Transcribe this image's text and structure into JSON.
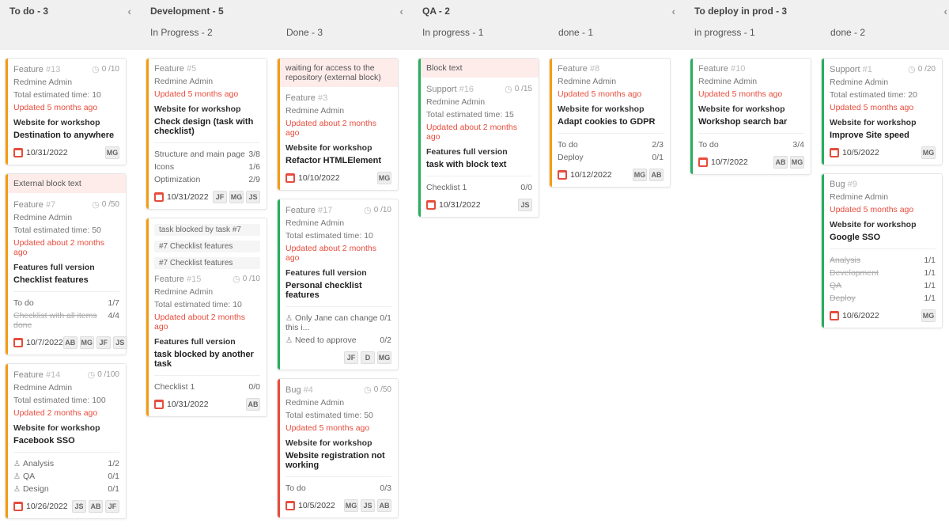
{
  "columns": [
    {
      "title": "To do - 3",
      "collapsible": true,
      "sub": null,
      "cards": [
        {
          "stripe": "orange",
          "tracker": "Feature",
          "id": "#13",
          "progress": "0 /10",
          "author": "Redmine Admin",
          "est": "Total estimated time: 10",
          "updated": "Updated 5 months ago",
          "project": "Website for workshop",
          "subject": "Destination to anywhere",
          "date": "10/31/2022",
          "avatars": [
            "MG"
          ]
        },
        {
          "stripe": "orange",
          "banner": "External block text",
          "tracker": "Feature",
          "id": "#7",
          "progress": "0 /50",
          "author": "Redmine Admin",
          "est": "Total estimated time: 50",
          "updated": "Updated about 2 months ago",
          "project": "Features full version",
          "subject": "Checklist features",
          "rows": [
            {
              "label": "To do",
              "val": "1/7"
            },
            {
              "label": "Checklist with all items done",
              "val": "4/4",
              "strike": true
            }
          ],
          "date": "10/7/2022",
          "avatars": [
            "AB",
            "MG",
            "JF",
            "JS"
          ]
        },
        {
          "stripe": "orange",
          "tracker": "Feature",
          "id": "#14",
          "progress": "0 /100",
          "author": "Redmine Admin",
          "est": "Total estimated time: 100",
          "updated": "Updated 2 months ago",
          "project": "Website for workshop",
          "subject": "Facebook SSO",
          "rows": [
            {
              "label": "Analysis",
              "val": "1/2",
              "person": true
            },
            {
              "label": "QA",
              "val": "0/1",
              "person": true
            },
            {
              "label": "Design",
              "val": "0/1",
              "person": true
            }
          ],
          "date": "10/26/2022",
          "avatars": [
            "JS",
            "AB",
            "JF"
          ]
        }
      ]
    },
    {
      "title": "Development - 5",
      "collapsible": true,
      "sub": [
        {
          "title": "In Progress - 2",
          "cards": [
            {
              "stripe": "orange",
              "tracker": "Feature",
              "id": "#5",
              "author": "Redmine Admin",
              "updated": "Updated 5 months ago",
              "project": "Website for workshop",
              "subject": "Check design (task with checklist)",
              "rows": [
                {
                  "label": "Structure and main page",
                  "val": "3/8"
                },
                {
                  "label": "Icons",
                  "val": "1/6"
                },
                {
                  "label": "Optimization",
                  "val": "2/9"
                }
              ],
              "date": "10/31/2022",
              "avatars": [
                "JF",
                "MG",
                "JS"
              ]
            },
            {
              "stripe": "orange",
              "chips": [
                "task blocked by task #7",
                "#7 Checklist features",
                "#7 Checklist features"
              ],
              "tracker": "Feature",
              "id": "#15",
              "progress": "0 /10",
              "author": "Redmine Admin",
              "est": "Total estimated time: 10",
              "updated": "Updated about 2 months ago",
              "project": "Features full version",
              "subject": "task blocked by another task",
              "rows": [
                {
                  "label": "Checklist 1",
                  "val": "0/0"
                }
              ],
              "date": "10/31/2022",
              "avatars": [
                "AB"
              ]
            }
          ]
        },
        {
          "title": "Done - 3",
          "cards": [
            {
              "stripe": "orange",
              "banner": "waiting for access to the repository (external block)",
              "tracker": "Feature",
              "id": "#3",
              "author": "Redmine Admin",
              "updated": "Updated about 2 months ago",
              "project": "Website for workshop",
              "subject": "Refactor HTMLElement",
              "date": "10/10/2022",
              "avatars": [
                "MG"
              ]
            },
            {
              "stripe": "green",
              "tracker": "Feature",
              "id": "#17",
              "progress": "0 /10",
              "author": "Redmine Admin",
              "est": "Total estimated time: 10",
              "updated": "Updated about 2 months ago",
              "project": "Features full version",
              "subject": "Personal checklist features",
              "rows": [
                {
                  "label": "Only Jane can change this i...",
                  "val": "0/1",
                  "person": true
                },
                {
                  "label": "Need to approve",
                  "val": "0/2",
                  "person": true
                }
              ],
              "avatars": [
                "JF",
                "D",
                "MG"
              ]
            },
            {
              "stripe": "red",
              "tracker": "Bug",
              "id": "#4",
              "progress": "0 /50",
              "author": "Redmine Admin",
              "est": "Total estimated time: 50",
              "updated": "Updated 5 months ago",
              "project": "Website for workshop",
              "subject": "Website registration not working",
              "rows": [
                {
                  "label": "To do",
                  "val": "0/3"
                }
              ],
              "date": "10/5/2022",
              "avatars": [
                "MG",
                "JS",
                "AB"
              ]
            }
          ]
        }
      ]
    },
    {
      "title": "QA - 2",
      "collapsible": true,
      "sub": [
        {
          "title": "In progress - 1",
          "cards": [
            {
              "stripe": "green",
              "banner": "Block text",
              "tracker": "Support",
              "id": "#16",
              "progress": "0 /15",
              "author": "Redmine Admin",
              "est": "Total estimated time: 15",
              "updated": "Updated about 2 months ago",
              "project": "Features full version",
              "subject": "task with block text",
              "rows": [
                {
                  "label": "Checklist 1",
                  "val": "0/0"
                }
              ],
              "date": "10/31/2022",
              "avatars": [
                "JS"
              ]
            }
          ]
        },
        {
          "title": "done - 1",
          "cards": [
            {
              "stripe": "orange",
              "tracker": "Feature",
              "id": "#8",
              "author": "Redmine Admin",
              "updated": "Updated 5 months ago",
              "project": "Website for workshop",
              "subject": "Adapt cookies to GDPR",
              "rows": [
                {
                  "label": "To do",
                  "val": "2/3"
                },
                {
                  "label": "Deploy",
                  "val": "0/1"
                }
              ],
              "date": "10/12/2022",
              "avatars": [
                "MG",
                "AB"
              ]
            }
          ]
        }
      ]
    },
    {
      "title": "To deploy in prod - 3",
      "collapsible": true,
      "sub": [
        {
          "title": "in progress - 1",
          "cards": [
            {
              "stripe": "green",
              "tracker": "Feature",
              "id": "#10",
              "author": "Redmine Admin",
              "updated": "Updated 5 months ago",
              "project": "Website for workshop",
              "subject": "Workshop search bar",
              "rows": [
                {
                  "label": "To do",
                  "val": "3/4"
                }
              ],
              "date": "10/7/2022",
              "avatars": [
                "AB",
                "MG"
              ]
            }
          ]
        },
        {
          "title": "done - 2",
          "cards": [
            {
              "stripe": "green",
              "tracker": "Support",
              "id": "#1",
              "progress": "0 /20",
              "author": "Redmine Admin",
              "est": "Total estimated time: 20",
              "updated": "Updated 5 months ago",
              "project": "Website for workshop",
              "subject": "Improve Site speed",
              "date": "10/5/2022",
              "avatars": [
                "MG"
              ]
            },
            {
              "stripe": "green",
              "tracker": "Bug",
              "id": "#9",
              "author": "Redmine Admin",
              "updated": "Updated 5 months ago",
              "project": "Website for workshop",
              "subject": "Google SSO",
              "rows": [
                {
                  "label": "Analysis",
                  "val": "1/1",
                  "strike": true
                },
                {
                  "label": "Development",
                  "val": "1/1",
                  "strike": true
                },
                {
                  "label": "QA",
                  "val": "1/1",
                  "strike": true
                },
                {
                  "label": "Deploy",
                  "val": "1/1",
                  "strike": true
                }
              ],
              "date": "10/6/2022",
              "avatars": [
                "MG"
              ]
            }
          ]
        }
      ]
    }
  ]
}
